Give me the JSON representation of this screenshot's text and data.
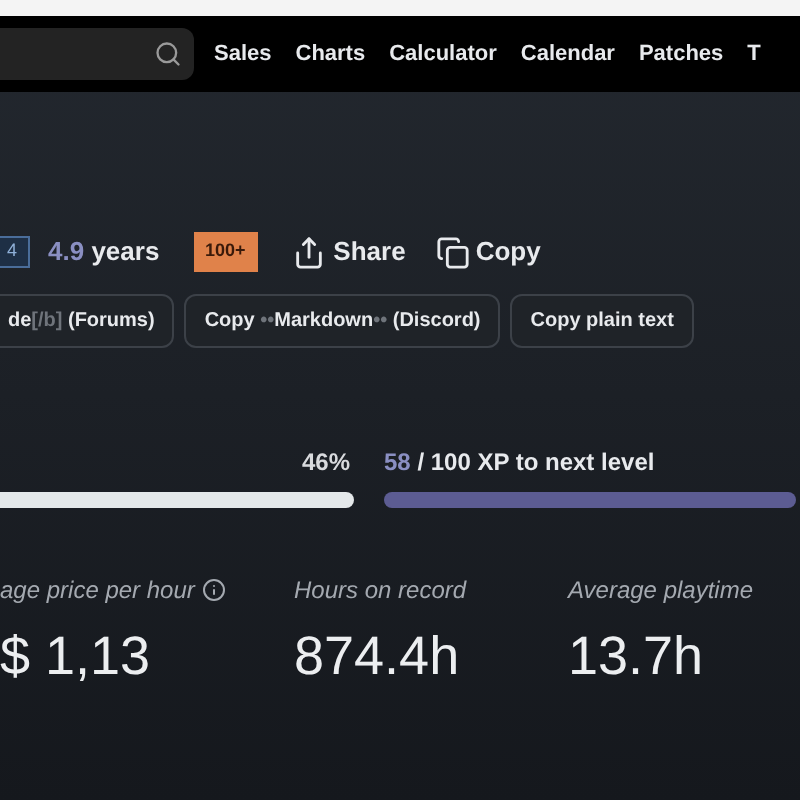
{
  "nav": {
    "items": [
      "Sales",
      "Charts",
      "Calculator",
      "Calendar",
      "Patches",
      "T"
    ]
  },
  "info_row": {
    "level_badge": "4",
    "years": [
      {
        "text": "4.9",
        "dim": true
      },
      {
        "text": " years",
        "dim": false
      }
    ],
    "badge": "100+",
    "share": "Share",
    "copy": "Copy"
  },
  "copy_buttons": [
    [
      {
        "text": "de",
        "dim": false
      },
      {
        "text": "[/b]",
        "dim": true
      },
      {
        "text": " (Forums)",
        "dim": false
      }
    ],
    [
      {
        "text": "Copy ",
        "dim": false
      },
      {
        "text": "••",
        "dim": true
      },
      {
        "text": "Markdown",
        "dim": false
      },
      {
        "text": "••",
        "dim": true
      },
      {
        "text": " (Discord)",
        "dim": false
      }
    ],
    [
      {
        "text": "Copy plain text",
        "dim": false
      }
    ]
  ],
  "progress": {
    "percent": "46%",
    "xp": [
      {
        "text": "58",
        "dim": true
      },
      {
        "text": " / 100 XP to next level",
        "dim": false
      }
    ]
  },
  "stats": [
    {
      "label": "age price per hour",
      "info": true,
      "value": "$ 1,13"
    },
    {
      "label": "Hours on record",
      "info": false,
      "value": "874.4h"
    },
    {
      "label": "Average playtime",
      "info": false,
      "value": "13.7h"
    }
  ]
}
